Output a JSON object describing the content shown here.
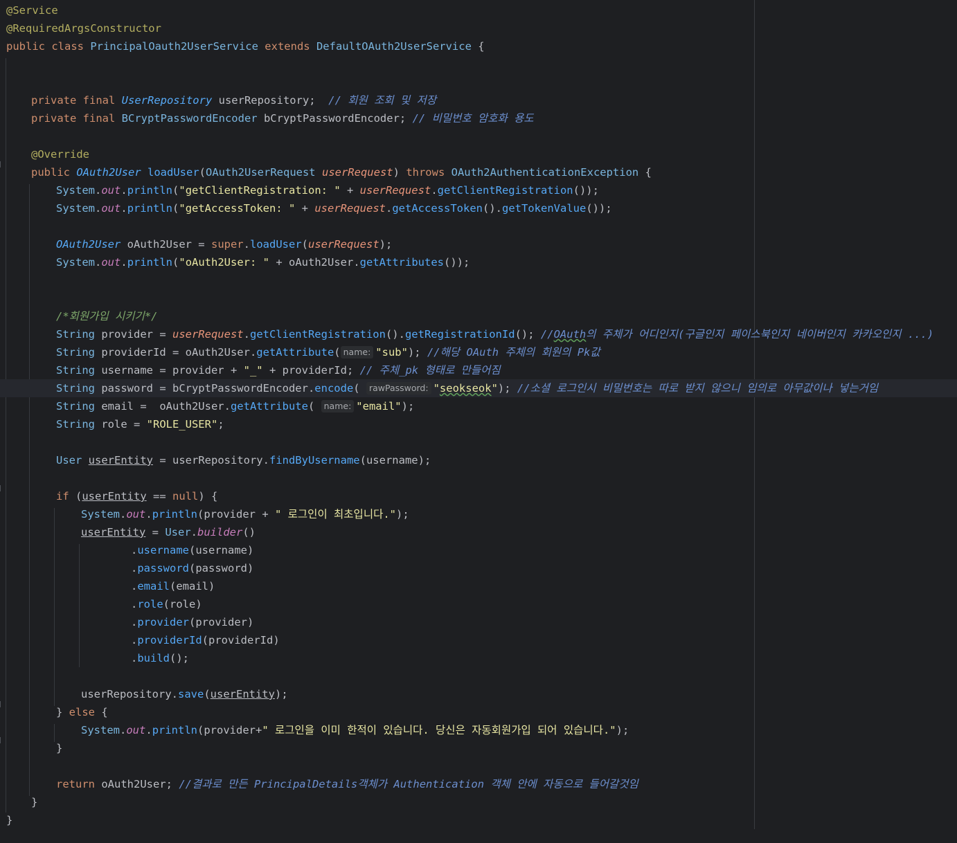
{
  "editor": {
    "language": "java",
    "current_line": 22,
    "lines": [
      {
        "n": 1,
        "indent": 0,
        "tokens": [
          {
            "t": "@Service",
            "c": "ann"
          }
        ]
      },
      {
        "n": 2,
        "indent": 0,
        "tokens": [
          {
            "t": "@RequiredArgsConstructor",
            "c": "ann"
          }
        ]
      },
      {
        "n": 3,
        "indent": 0,
        "tokens": [
          {
            "t": "public class ",
            "c": "kw"
          },
          {
            "t": "PrincipalOauth2UserService",
            "c": "cls"
          },
          {
            "t": " extends ",
            "c": "kw"
          },
          {
            "t": "DefaultOAuth2UserService",
            "c": "cls"
          },
          {
            "t": " {",
            "c": "pl"
          }
        ]
      },
      {
        "n": 4,
        "indent": 0,
        "tokens": []
      },
      {
        "n": 5,
        "indent": 0,
        "tokens": []
      },
      {
        "n": 6,
        "indent": 1,
        "tokens": [
          {
            "t": "private final ",
            "c": "kw"
          },
          {
            "t": "UserRepository",
            "c": "intf"
          },
          {
            "t": " userRepository;  ",
            "c": "pl"
          },
          {
            "t": "// 회원 조회 및 저장",
            "c": "cmtb"
          }
        ]
      },
      {
        "n": 7,
        "indent": 1,
        "tokens": [
          {
            "t": "private final ",
            "c": "kw"
          },
          {
            "t": "BCryptPasswordEncoder",
            "c": "cls"
          },
          {
            "t": " bCryptPasswordEncoder; ",
            "c": "pl"
          },
          {
            "t": "// 비밀번호 암호화 용도",
            "c": "cmtb"
          }
        ]
      },
      {
        "n": 8,
        "indent": 0,
        "tokens": []
      },
      {
        "n": 9,
        "indent": 1,
        "tokens": [
          {
            "t": "@Override",
            "c": "ann"
          }
        ]
      },
      {
        "n": 10,
        "indent": 1,
        "fold": true,
        "tokens": [
          {
            "t": "public ",
            "c": "kw"
          },
          {
            "t": "OAuth2User",
            "c": "intf"
          },
          {
            "t": " ",
            "c": "pl"
          },
          {
            "t": "loadUser",
            "c": "fn"
          },
          {
            "t": "(",
            "c": "pl"
          },
          {
            "t": "OAuth2UserRequest",
            "c": "cls"
          },
          {
            "t": " ",
            "c": "pl"
          },
          {
            "t": "userRequest",
            "c": "param"
          },
          {
            "t": ") ",
            "c": "pl"
          },
          {
            "t": "throws ",
            "c": "kw"
          },
          {
            "t": "OAuth2AuthenticationException",
            "c": "cls"
          },
          {
            "t": " {",
            "c": "pl"
          }
        ]
      },
      {
        "n": 11,
        "indent": 2,
        "tokens": [
          {
            "t": "System",
            "c": "cls"
          },
          {
            "t": ".",
            "c": "pl"
          },
          {
            "t": "out",
            "c": "stat"
          },
          {
            "t": ".",
            "c": "pl"
          },
          {
            "t": "println",
            "c": "call"
          },
          {
            "t": "(",
            "c": "pl"
          },
          {
            "t": "\"getClientRegistration: \"",
            "c": "strk"
          },
          {
            "t": " + ",
            "c": "pl"
          },
          {
            "t": "userRequest",
            "c": "param"
          },
          {
            "t": ".",
            "c": "pl"
          },
          {
            "t": "getClientRegistration",
            "c": "call"
          },
          {
            "t": "());",
            "c": "pl"
          }
        ]
      },
      {
        "n": 12,
        "indent": 2,
        "tokens": [
          {
            "t": "System",
            "c": "cls"
          },
          {
            "t": ".",
            "c": "pl"
          },
          {
            "t": "out",
            "c": "stat"
          },
          {
            "t": ".",
            "c": "pl"
          },
          {
            "t": "println",
            "c": "call"
          },
          {
            "t": "(",
            "c": "pl"
          },
          {
            "t": "\"getAccessToken: \"",
            "c": "strk"
          },
          {
            "t": " + ",
            "c": "pl"
          },
          {
            "t": "userRequest",
            "c": "param"
          },
          {
            "t": ".",
            "c": "pl"
          },
          {
            "t": "getAccessToken",
            "c": "call"
          },
          {
            "t": "().",
            "c": "pl"
          },
          {
            "t": "getTokenValue",
            "c": "call"
          },
          {
            "t": "());",
            "c": "pl"
          }
        ]
      },
      {
        "n": 13,
        "indent": 0,
        "tokens": []
      },
      {
        "n": 14,
        "indent": 2,
        "tokens": [
          {
            "t": "OAuth2User",
            "c": "intf"
          },
          {
            "t": " oAuth2User = ",
            "c": "pl"
          },
          {
            "t": "super",
            "c": "kw"
          },
          {
            "t": ".",
            "c": "pl"
          },
          {
            "t": "loadUser",
            "c": "call"
          },
          {
            "t": "(",
            "c": "pl"
          },
          {
            "t": "userRequest",
            "c": "param"
          },
          {
            "t": ");",
            "c": "pl"
          }
        ]
      },
      {
        "n": 15,
        "indent": 2,
        "tokens": [
          {
            "t": "System",
            "c": "cls"
          },
          {
            "t": ".",
            "c": "pl"
          },
          {
            "t": "out",
            "c": "stat"
          },
          {
            "t": ".",
            "c": "pl"
          },
          {
            "t": "println",
            "c": "call"
          },
          {
            "t": "(",
            "c": "pl"
          },
          {
            "t": "\"oAuth2User: \"",
            "c": "strk"
          },
          {
            "t": " + oAuth2User.",
            "c": "pl"
          },
          {
            "t": "getAttributes",
            "c": "call"
          },
          {
            "t": "());",
            "c": "pl"
          }
        ]
      },
      {
        "n": 16,
        "indent": 0,
        "tokens": []
      },
      {
        "n": 17,
        "indent": 0,
        "tokens": []
      },
      {
        "n": 18,
        "indent": 2,
        "tokens": [
          {
            "t": "/*회원가입 시키기*/",
            "c": "doc"
          }
        ]
      },
      {
        "n": 19,
        "indent": 2,
        "tokens": [
          {
            "t": "String",
            "c": "cls"
          },
          {
            "t": " provider = ",
            "c": "pl"
          },
          {
            "t": "userRequest",
            "c": "param"
          },
          {
            "t": ".",
            "c": "pl"
          },
          {
            "t": "getClientRegistration",
            "c": "call"
          },
          {
            "t": "().",
            "c": "pl"
          },
          {
            "t": "getRegistrationId",
            "c": "call"
          },
          {
            "t": "(); ",
            "c": "pl"
          },
          {
            "t": "//",
            "c": "cmtb"
          },
          {
            "t": "OAuth",
            "c": "cmtb wavy"
          },
          {
            "t": "의 주체가 어디인지(구글인지 페이스북인지 네이버인지 카카오인지 ...)",
            "c": "cmtb"
          }
        ]
      },
      {
        "n": 20,
        "indent": 2,
        "tokens": [
          {
            "t": "String",
            "c": "cls"
          },
          {
            "t": " providerId = oAuth2User.",
            "c": "pl"
          },
          {
            "t": "getAttribute",
            "c": "call"
          },
          {
            "t": "(",
            "c": "pl"
          },
          {
            "t": "name:",
            "c": "hint"
          },
          {
            "t": "\"sub\"",
            "c": "strk"
          },
          {
            "t": "); ",
            "c": "pl"
          },
          {
            "t": "//해당 OAuth 주체의 회원의 Pk값",
            "c": "cmtb"
          }
        ]
      },
      {
        "n": 21,
        "indent": 2,
        "tokens": [
          {
            "t": "String",
            "c": "cls"
          },
          {
            "t": " username = provider + ",
            "c": "pl"
          },
          {
            "t": "\"_\"",
            "c": "strk"
          },
          {
            "t": " + providerId; ",
            "c": "pl"
          },
          {
            "t": "// 주체_pk 형태로 만들어짐",
            "c": "cmtb"
          }
        ]
      },
      {
        "n": 22,
        "indent": 2,
        "tokens": [
          {
            "t": "String",
            "c": "cls"
          },
          {
            "t": " password = bCryptPasswordEncoder.",
            "c": "pl"
          },
          {
            "t": "encode",
            "c": "call"
          },
          {
            "t": "( ",
            "c": "pl"
          },
          {
            "t": "rawPassword:",
            "c": "hint"
          },
          {
            "t": "\"",
            "c": "strk"
          },
          {
            "t": "seokseok",
            "c": "strk wavy"
          },
          {
            "t": "\"",
            "c": "strk"
          },
          {
            "t": "); ",
            "c": "pl"
          },
          {
            "t": "//소셜 로그인시 비밀번호는 따로 받지 않으니 임의로 아무값이나 넣는거임",
            "c": "cmtb"
          }
        ]
      },
      {
        "n": 23,
        "indent": 2,
        "tokens": [
          {
            "t": "String",
            "c": "cls"
          },
          {
            "t": " email =  oAuth2User.",
            "c": "pl"
          },
          {
            "t": "getAttribute",
            "c": "call"
          },
          {
            "t": "( ",
            "c": "pl"
          },
          {
            "t": "name:",
            "c": "hint"
          },
          {
            "t": "\"email\"",
            "c": "strk"
          },
          {
            "t": ");",
            "c": "pl"
          }
        ]
      },
      {
        "n": 24,
        "indent": 2,
        "tokens": [
          {
            "t": "String",
            "c": "cls"
          },
          {
            "t": " role = ",
            "c": "pl"
          },
          {
            "t": "\"ROLE_USER\"",
            "c": "strk"
          },
          {
            "t": ";",
            "c": "pl"
          }
        ]
      },
      {
        "n": 25,
        "indent": 0,
        "tokens": []
      },
      {
        "n": 26,
        "indent": 2,
        "tokens": [
          {
            "t": "User",
            "c": "cls"
          },
          {
            "t": " ",
            "c": "pl"
          },
          {
            "t": "userEntity",
            "c": "pl ul"
          },
          {
            "t": " = userRepository.",
            "c": "pl"
          },
          {
            "t": "findByUsername",
            "c": "call"
          },
          {
            "t": "(username);",
            "c": "pl"
          }
        ]
      },
      {
        "n": 27,
        "indent": 0,
        "tokens": []
      },
      {
        "n": 28,
        "indent": 2,
        "fold": true,
        "tokens": [
          {
            "t": "if",
            "c": "kw"
          },
          {
            "t": " (",
            "c": "pl"
          },
          {
            "t": "userEntity",
            "c": "pl ul"
          },
          {
            "t": " == ",
            "c": "pl"
          },
          {
            "t": "null",
            "c": "kw"
          },
          {
            "t": ") {",
            "c": "pl"
          }
        ]
      },
      {
        "n": 29,
        "indent": 3,
        "tokens": [
          {
            "t": "System",
            "c": "cls"
          },
          {
            "t": ".",
            "c": "pl"
          },
          {
            "t": "out",
            "c": "stat"
          },
          {
            "t": ".",
            "c": "pl"
          },
          {
            "t": "println",
            "c": "call"
          },
          {
            "t": "(provider + ",
            "c": "pl"
          },
          {
            "t": "\" 로그인이 최초입니다.\"",
            "c": "strk"
          },
          {
            "t": ");",
            "c": "pl"
          }
        ]
      },
      {
        "n": 30,
        "indent": 3,
        "tokens": [
          {
            "t": "userEntity",
            "c": "pl ul"
          },
          {
            "t": " = ",
            "c": "pl"
          },
          {
            "t": "User",
            "c": "cls"
          },
          {
            "t": ".",
            "c": "pl"
          },
          {
            "t": "builder",
            "c": "stat"
          },
          {
            "t": "()",
            "c": "pl"
          }
        ]
      },
      {
        "n": 31,
        "indent": 5,
        "tokens": [
          {
            "t": ".",
            "c": "pl"
          },
          {
            "t": "username",
            "c": "call"
          },
          {
            "t": "(username)",
            "c": "pl"
          }
        ]
      },
      {
        "n": 32,
        "indent": 5,
        "tokens": [
          {
            "t": ".",
            "c": "pl"
          },
          {
            "t": "password",
            "c": "call"
          },
          {
            "t": "(password)",
            "c": "pl"
          }
        ]
      },
      {
        "n": 33,
        "indent": 5,
        "tokens": [
          {
            "t": ".",
            "c": "pl"
          },
          {
            "t": "email",
            "c": "call"
          },
          {
            "t": "(email)",
            "c": "pl"
          }
        ]
      },
      {
        "n": 34,
        "indent": 5,
        "tokens": [
          {
            "t": ".",
            "c": "pl"
          },
          {
            "t": "role",
            "c": "call"
          },
          {
            "t": "(role)",
            "c": "pl"
          }
        ]
      },
      {
        "n": 35,
        "indent": 5,
        "tokens": [
          {
            "t": ".",
            "c": "pl"
          },
          {
            "t": "provider",
            "c": "call"
          },
          {
            "t": "(provider)",
            "c": "pl"
          }
        ]
      },
      {
        "n": 36,
        "indent": 5,
        "tokens": [
          {
            "t": ".",
            "c": "pl"
          },
          {
            "t": "providerId",
            "c": "call"
          },
          {
            "t": "(providerId)",
            "c": "pl"
          }
        ]
      },
      {
        "n": 37,
        "indent": 5,
        "tokens": [
          {
            "t": ".",
            "c": "pl"
          },
          {
            "t": "build",
            "c": "call"
          },
          {
            "t": "();",
            "c": "pl"
          }
        ]
      },
      {
        "n": 38,
        "indent": 0,
        "tokens": []
      },
      {
        "n": 39,
        "indent": 3,
        "tokens": [
          {
            "t": "userRepository.",
            "c": "pl"
          },
          {
            "t": "save",
            "c": "call"
          },
          {
            "t": "(",
            "c": "pl"
          },
          {
            "t": "userEntity",
            "c": "pl ul"
          },
          {
            "t": ");",
            "c": "pl"
          }
        ]
      },
      {
        "n": 40,
        "indent": 2,
        "fold": true,
        "tokens": [
          {
            "t": "} ",
            "c": "pl"
          },
          {
            "t": "else",
            "c": "kw"
          },
          {
            "t": " {",
            "c": "pl"
          }
        ]
      },
      {
        "n": 41,
        "indent": 3,
        "tokens": [
          {
            "t": "System",
            "c": "cls"
          },
          {
            "t": ".",
            "c": "pl"
          },
          {
            "t": "out",
            "c": "stat"
          },
          {
            "t": ".",
            "c": "pl"
          },
          {
            "t": "println",
            "c": "call"
          },
          {
            "t": "(provider+",
            "c": "pl"
          },
          {
            "t": "\" 로그인을 이미 한적이 있습니다. 당신은 자동회원가입 되어 있습니다.\"",
            "c": "strk"
          },
          {
            "t": ");",
            "c": "pl"
          }
        ]
      },
      {
        "n": 42,
        "indent": 2,
        "fold": true,
        "tokens": [
          {
            "t": "}",
            "c": "pl"
          }
        ]
      },
      {
        "n": 43,
        "indent": 0,
        "tokens": []
      },
      {
        "n": 44,
        "indent": 2,
        "tokens": [
          {
            "t": "return",
            "c": "kw"
          },
          {
            "t": " oAuth2User; ",
            "c": "pl"
          },
          {
            "t": "//결과로 만든 PrincipalDetails객체가 Authentication 객체 안에 자동으로 들어갈것임",
            "c": "cmtb"
          }
        ]
      },
      {
        "n": 45,
        "indent": 1,
        "tokens": [
          {
            "t": "}",
            "c": "pl"
          }
        ]
      },
      {
        "n": 46,
        "indent": 0,
        "tokens": [
          {
            "t": "}",
            "c": "pl"
          }
        ]
      }
    ]
  }
}
